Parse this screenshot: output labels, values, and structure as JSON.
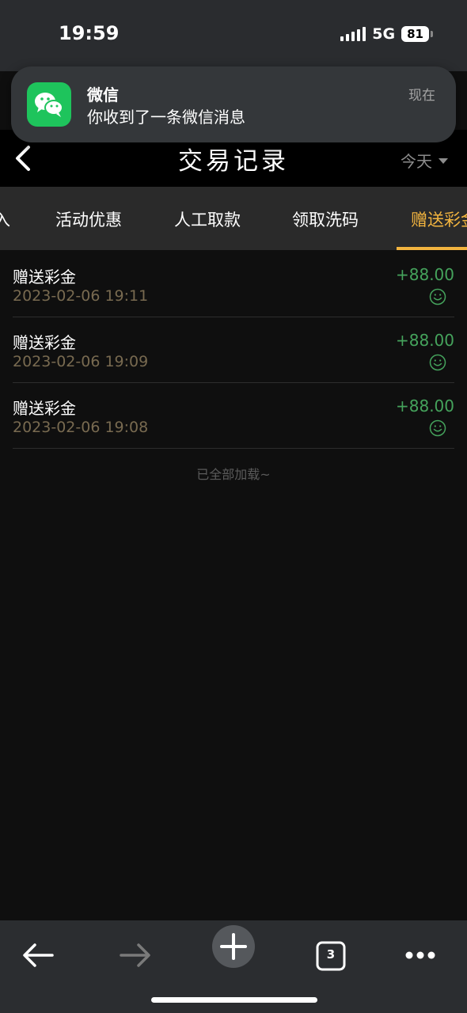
{
  "status_bar": {
    "time": "19:59",
    "network": "5G",
    "battery": "81"
  },
  "notification": {
    "app_icon": "wechat-icon",
    "app_name": "微信",
    "message": "你收到了一条微信消息",
    "time": "现在"
  },
  "header": {
    "back_icon": "chevron-left-icon",
    "title": "交易记录",
    "date_filter": "今天",
    "date_filter_icon": "caret-down-icon"
  },
  "tabs": [
    {
      "label": "入",
      "active": false
    },
    {
      "label": "活动优惠",
      "active": false
    },
    {
      "label": "人工取款",
      "active": false
    },
    {
      "label": "领取洗码",
      "active": false
    },
    {
      "label": "赠送彩金",
      "active": true
    }
  ],
  "records": [
    {
      "type": "赠送彩金",
      "time": "2023-02-06 19:11",
      "amount": "+88.00",
      "status_icon": "smile-icon"
    },
    {
      "type": "赠送彩金",
      "time": "2023-02-06 19:09",
      "amount": "+88.00",
      "status_icon": "smile-icon"
    },
    {
      "type": "赠送彩金",
      "time": "2023-02-06 19:08",
      "amount": "+88.00",
      "status_icon": "smile-icon"
    }
  ],
  "load_status": "已全部加载~",
  "toolbar": {
    "back_icon": "arrow-left-icon",
    "forward_icon": "arrow-right-icon",
    "new_tab_icon": "plus-icon",
    "tab_count": "3",
    "menu_icon": "more-dots-icon"
  },
  "colors": {
    "accent": "#f2b43f",
    "amount_positive": "#45a35c",
    "date_text": "#786a50",
    "wechat_green": "#1ec45c"
  }
}
